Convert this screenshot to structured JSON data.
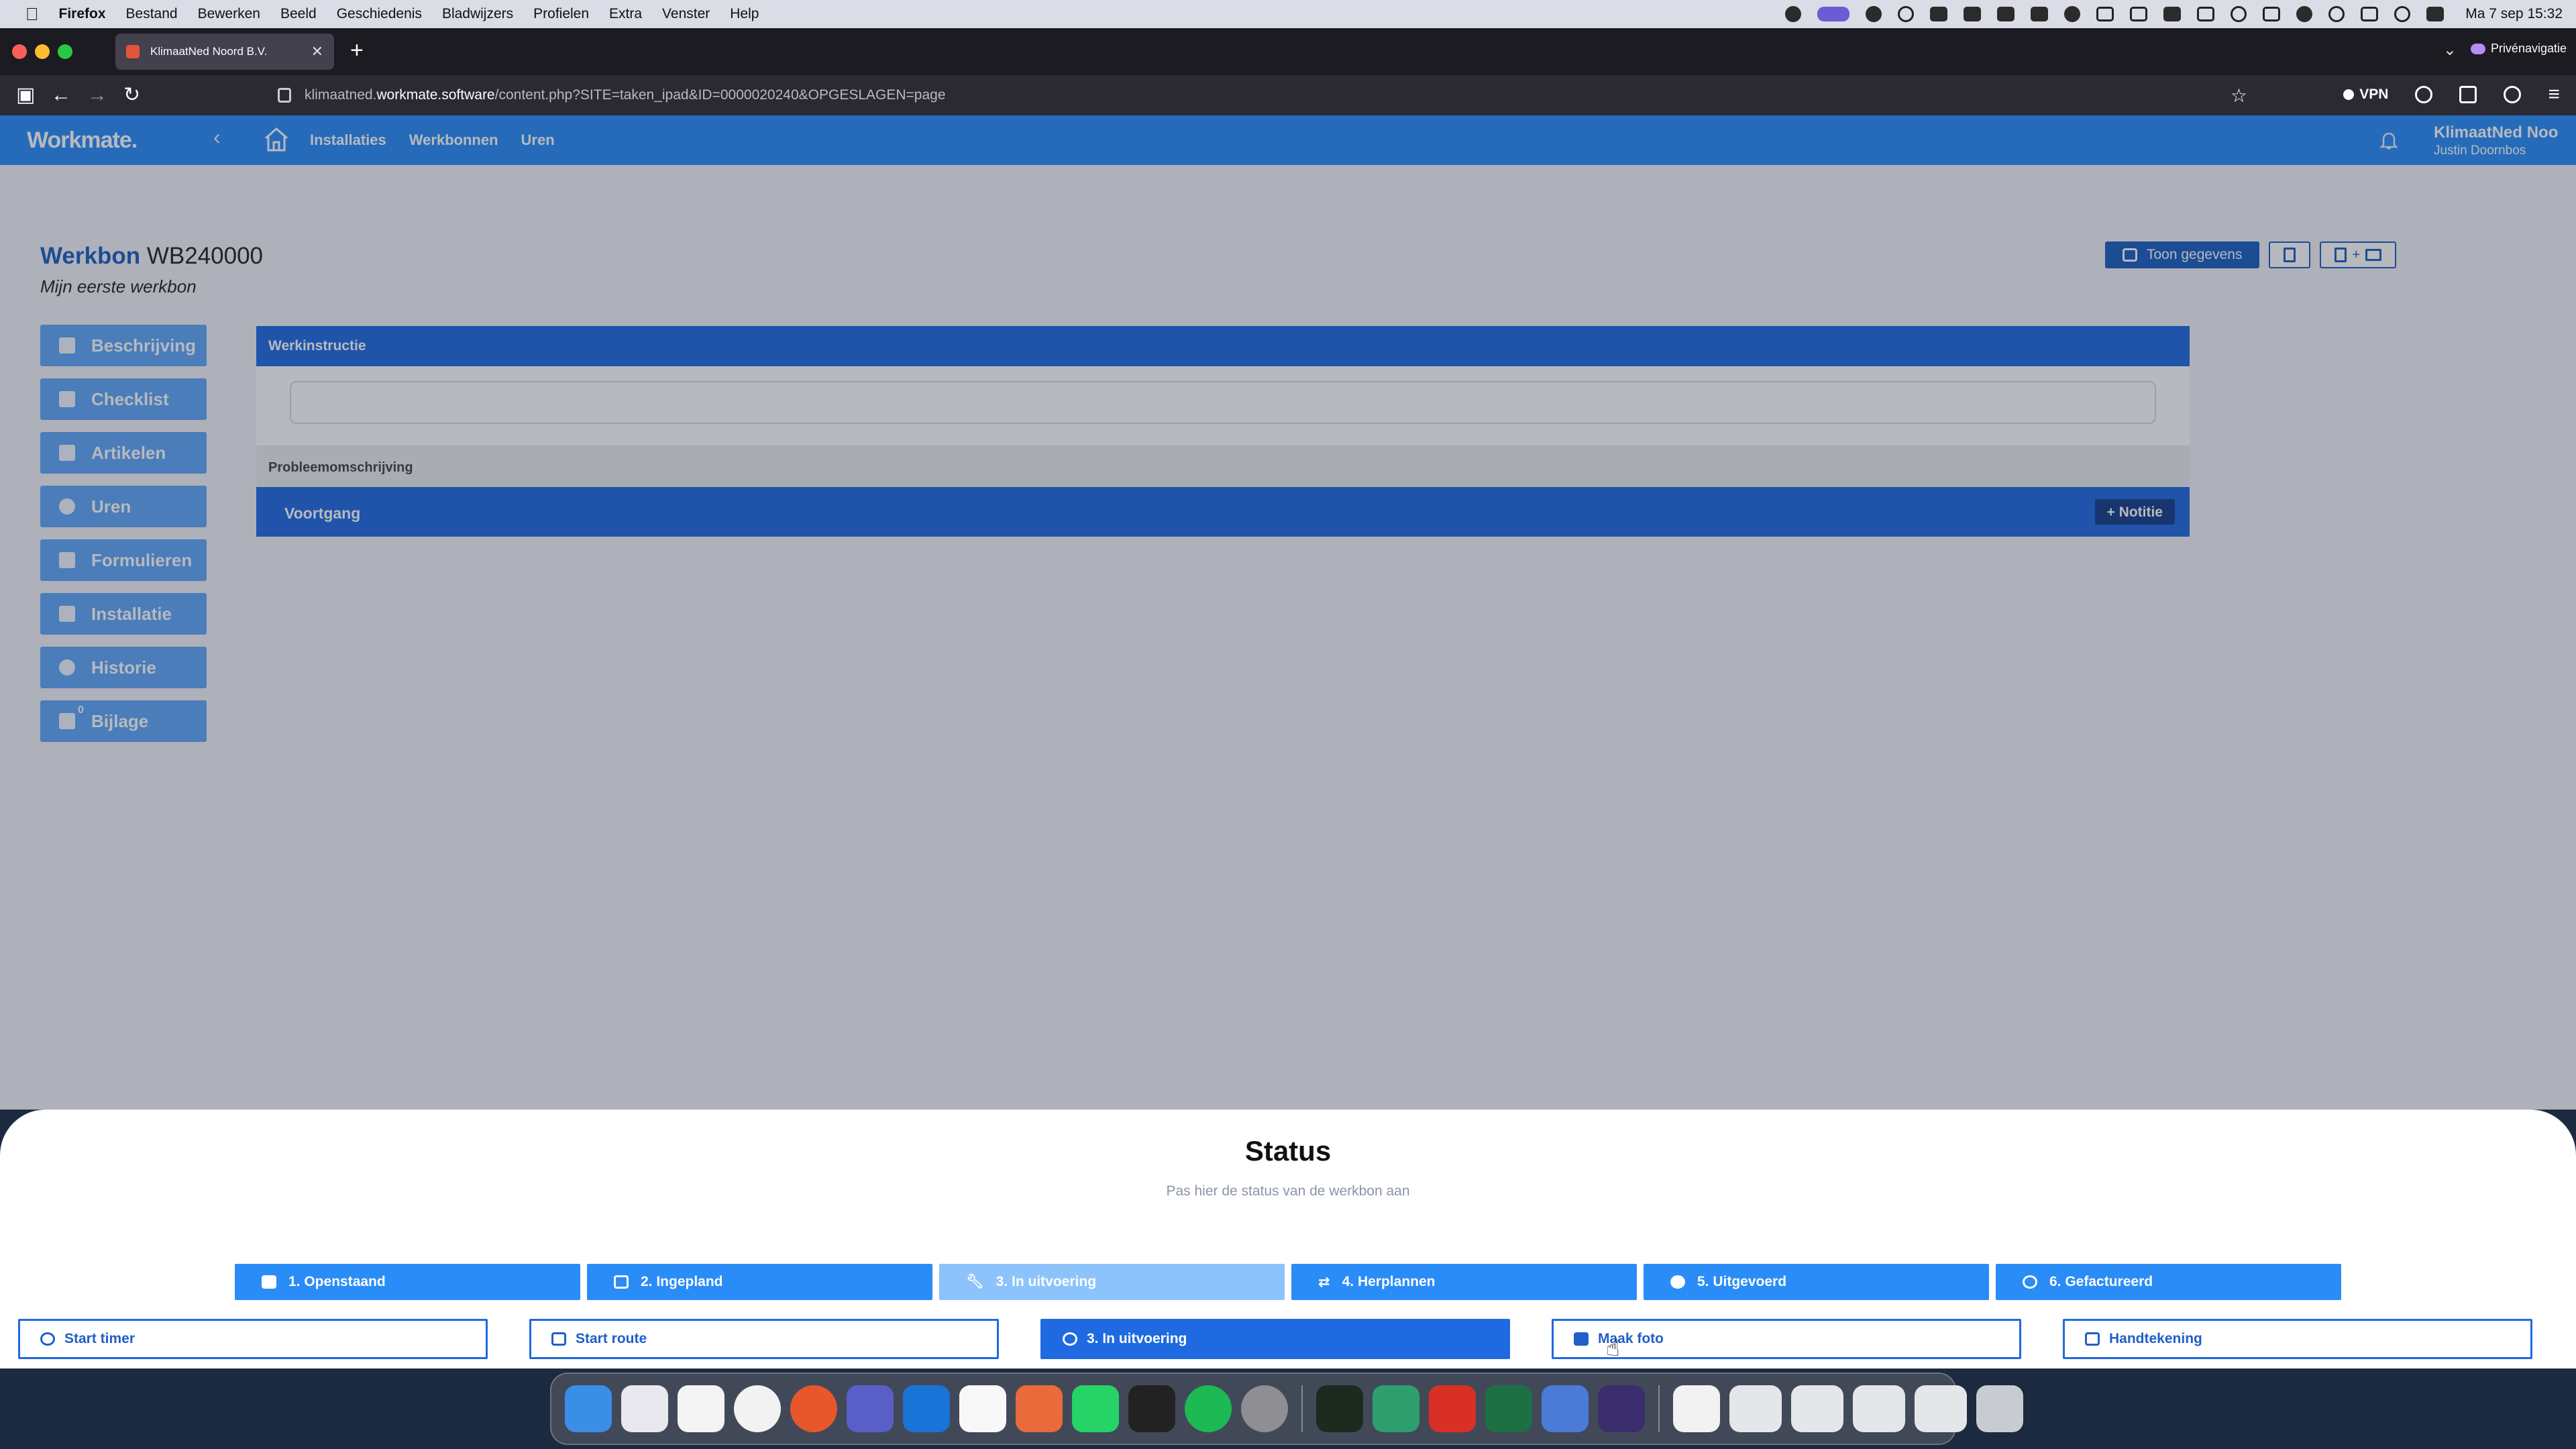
{
  "menubar": {
    "app_name": "Firefox",
    "items": [
      "Bestand",
      "Bewerken",
      "Beeld",
      "Geschiedenis",
      "Bladwijzers",
      "Profielen",
      "Extra",
      "Venster",
      "Help"
    ],
    "clock": "Ma 7 sep  15:32"
  },
  "browser": {
    "tab_title": "KlimaatNed Noord B.V.",
    "new_tab": "+",
    "url_prefix": "klimaatned.",
    "url_host": "workmate.software",
    "url_path": "/content.php?SITE=taken_ipad&ID=0000020240&OPGESLAGEN=page",
    "vpn_label": "VPN",
    "private_label": "Privénavigatie"
  },
  "app": {
    "logo": "Workmate.",
    "nav": [
      "Installaties",
      "Werkbonnen",
      "Uren"
    ],
    "company": "KlimaatNed Noo..",
    "user": "Justin Doornbos",
    "werkbon_label": "Werkbon",
    "werkbon_number": "WB240000",
    "werkbon_subtitle": "Mijn eerste werkbon",
    "toon_gegevens": "Toon gegevens",
    "pdf_mail_label": "+",
    "sidebar": [
      {
        "label": "Beschrijving",
        "icon": "comment-icon"
      },
      {
        "label": "Checklist",
        "icon": "list-icon"
      },
      {
        "label": "Artikelen",
        "icon": "box-icon"
      },
      {
        "label": "Uren",
        "icon": "user-icon"
      },
      {
        "label": "Formulieren",
        "icon": "form-icon"
      },
      {
        "label": "Installatie",
        "icon": "factory-icon"
      },
      {
        "label": "Historie",
        "icon": "history-icon"
      },
      {
        "label": "Bijlage",
        "icon": "folder-icon",
        "badge": "0"
      }
    ],
    "werkinstructie": "Werkinstructie",
    "probleemomschrijving": "Probleemomschrijving",
    "voortgang": "Voortgang",
    "notitie": "+ Notitie"
  },
  "status_sheet": {
    "title": "Status",
    "subtitle": "Pas hier de status van de werkbon aan",
    "statuses": [
      {
        "label": "1. Openstaand",
        "icon": "calendar-icon",
        "active": false
      },
      {
        "label": "2. Ingepland",
        "icon": "calendar-grid-icon",
        "active": false
      },
      {
        "label": "3. In uitvoering",
        "icon": "wrench-icon",
        "active": true
      },
      {
        "label": "4. Herplannen",
        "icon": "repeat-icon",
        "active": false
      },
      {
        "label": "5. Uitgevoerd",
        "icon": "check-circle-icon",
        "active": false
      },
      {
        "label": "6. Gefactureerd",
        "icon": "search-icon",
        "active": false
      }
    ],
    "actions": [
      {
        "label": "Start timer",
        "icon": "stopwatch-icon",
        "filled": false
      },
      {
        "label": "Start route",
        "icon": "route-icon",
        "filled": false
      },
      {
        "label": "3. In uitvoering",
        "icon": "user-icon",
        "filled": true
      },
      {
        "label": "Maak foto",
        "icon": "camera-icon",
        "filled": false
      },
      {
        "label": "Handtekening",
        "icon": "signature-icon",
        "filled": false
      }
    ]
  },
  "colors": {
    "brand_blue": "#2a8cf7",
    "dark_blue": "#1f6ae0",
    "active_status": "#8dc3fb"
  }
}
